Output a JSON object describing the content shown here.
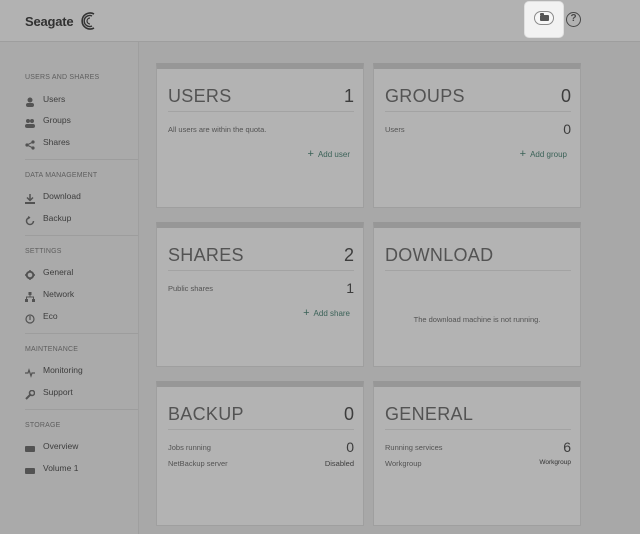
{
  "header": {
    "brand": "Seagate"
  },
  "sidebar": {
    "sections": [
      {
        "title": "USERS AND SHARES",
        "items": [
          {
            "label": "Users",
            "icon": "user-icon"
          },
          {
            "label": "Groups",
            "icon": "group-icon"
          },
          {
            "label": "Shares",
            "icon": "share-icon"
          }
        ]
      },
      {
        "title": "DATA MANAGEMENT",
        "items": [
          {
            "label": "Download",
            "icon": "download-icon"
          },
          {
            "label": "Backup",
            "icon": "backup-icon"
          }
        ]
      },
      {
        "title": "SETTINGS",
        "items": [
          {
            "label": "General",
            "icon": "gear-icon"
          },
          {
            "label": "Network",
            "icon": "network-icon"
          },
          {
            "label": "Eco",
            "icon": "eco-icon"
          }
        ]
      },
      {
        "title": "MAINTENANCE",
        "items": [
          {
            "label": "Monitoring",
            "icon": "monitoring-icon"
          },
          {
            "label": "Support",
            "icon": "wrench-icon"
          }
        ]
      },
      {
        "title": "STORAGE",
        "items": [
          {
            "label": "Overview",
            "icon": "disk-icon"
          },
          {
            "label": "Volume 1",
            "icon": "disk-icon"
          }
        ]
      }
    ]
  },
  "cards": {
    "users": {
      "title": "USERS",
      "count": "1",
      "text": "All users are within the quota.",
      "link": "Add user"
    },
    "groups": {
      "title": "GROUPS",
      "count": "0",
      "row_label": "Users",
      "row_value": "0",
      "link": "Add group"
    },
    "shares": {
      "title": "SHARES",
      "count": "2",
      "row_label": "Public shares",
      "row_value": "1",
      "link": "Add share"
    },
    "download": {
      "title": "DOWNLOAD",
      "message": "The download machine is not running."
    },
    "backup": {
      "title": "BACKUP",
      "count": "0",
      "rows": [
        {
          "label": "Jobs running",
          "value": "0"
        },
        {
          "label": "NetBackup server",
          "value": "Disabled"
        }
      ]
    },
    "general": {
      "title": "GENERAL",
      "rows": [
        {
          "label": "Running services",
          "value": "6"
        },
        {
          "label": "Workgroup",
          "value": "Workgroup"
        }
      ]
    }
  },
  "colors": {
    "accent_link": "#2f6b5b",
    "overlay": "#505050"
  }
}
